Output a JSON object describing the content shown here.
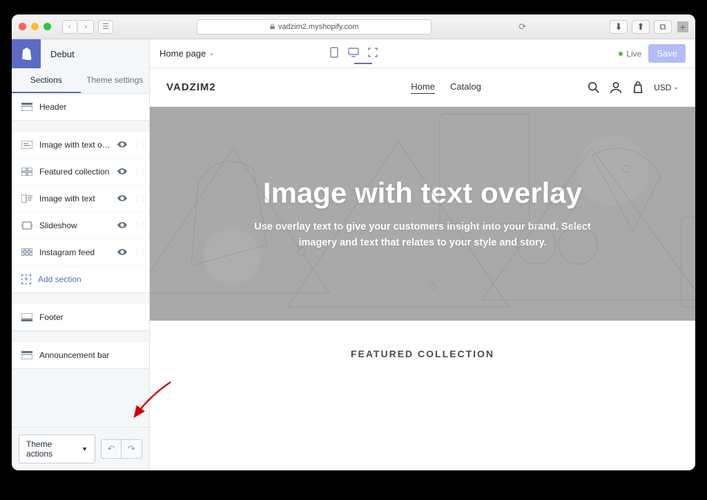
{
  "browser": {
    "url": "vadzim2.myshopify.com"
  },
  "app": {
    "theme_name": "Debut",
    "page_selector": "Home page",
    "live_label": "Live",
    "save_label": "Save"
  },
  "sidebar": {
    "tabs": [
      "Sections",
      "Theme settings"
    ],
    "header_item": "Header",
    "items": [
      "Image with text ov...",
      "Featured collection",
      "Image with text",
      "Slideshow",
      "Instagram feed"
    ],
    "add_section": "Add section",
    "footer_item": "Footer",
    "announcement_item": "Announcement bar",
    "theme_actions": "Theme actions"
  },
  "site": {
    "brand": "VADZIM2",
    "nav": {
      "home": "Home",
      "catalog": "Catalog"
    },
    "currency": "USD",
    "hero_title": "Image with text overlay",
    "hero_text": "Use overlay text to give your customers insight into your brand. Select imagery and text that relates to your style and story.",
    "featured_heading": "FEATURED COLLECTION"
  }
}
